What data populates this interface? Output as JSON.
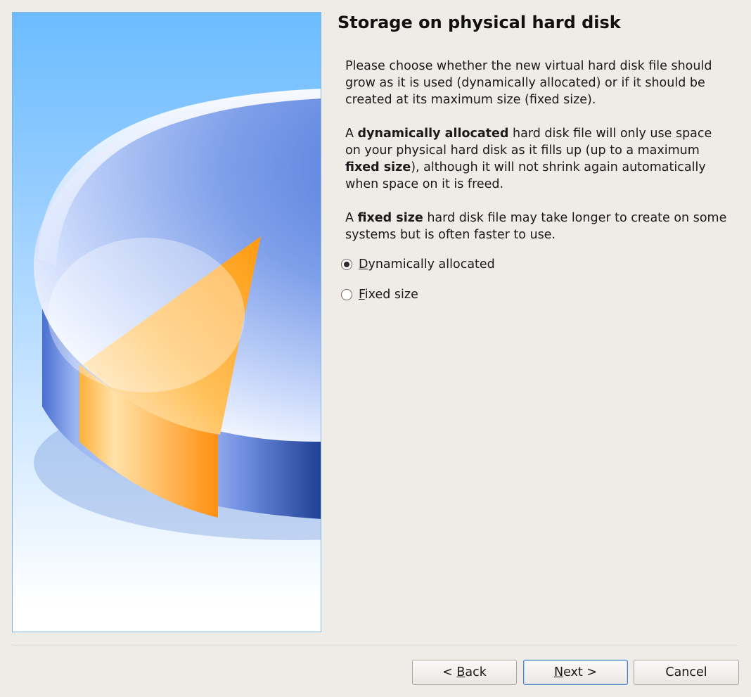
{
  "wizard": {
    "title": "Storage on physical hard disk",
    "paragraph1": "Please choose whether the new virtual hard disk file should grow as it is used (dynamically allocated) or if it should be created at its maximum size (fixed size).",
    "paragraph2": {
      "a": "A ",
      "b1": "dynamically allocated",
      "c": " hard disk file will only use space on your physical hard disk as it fills up (up to a maximum ",
      "b2": "fixed size",
      "d": "), although it will not shrink again automatically when space on it is freed."
    },
    "paragraph3": {
      "a": "A ",
      "b1": "fixed size",
      "c": " hard disk file may take longer to create on some systems but is often faster to use."
    },
    "options": [
      {
        "mnemonic": "D",
        "rest": "ynamically allocated",
        "checked": true
      },
      {
        "mnemonic": "F",
        "rest": "ixed size",
        "checked": false
      }
    ]
  },
  "buttons": {
    "back": {
      "pre": "< ",
      "mnemonic": "B",
      "rest": "ack"
    },
    "next": {
      "pre": "",
      "mnemonic": "N",
      "rest": "ext >"
    },
    "cancel": "Cancel"
  },
  "banner": {
    "icon": "hard-disk-pie-icon",
    "colors": {
      "sky": "#6cbcff",
      "disk_top": "#5a86e0",
      "slice": "#ff9a1a",
      "side_dark": "#1f3f93"
    }
  }
}
